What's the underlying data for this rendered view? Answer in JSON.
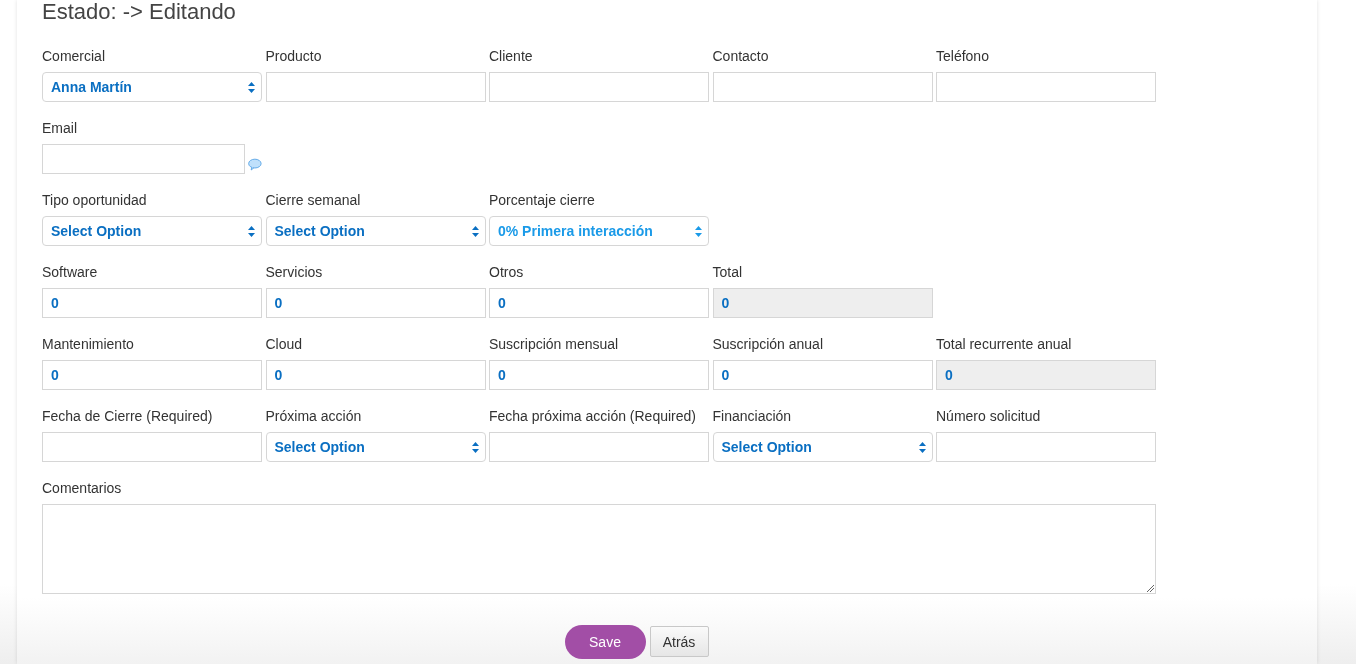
{
  "title": "Estado: -> Editando",
  "rows": [
    {
      "fields": [
        {
          "label": "Comercial",
          "kind": "select",
          "value": "Anna Martín"
        },
        {
          "label": "Producto",
          "kind": "text"
        },
        {
          "label": "Cliente",
          "kind": "text"
        },
        {
          "label": "Contacto",
          "kind": "text"
        },
        {
          "label": "Teléfono",
          "kind": "text"
        }
      ]
    },
    {
      "fields": [
        {
          "label": "Email",
          "kind": "text",
          "comment_icon": true
        }
      ]
    },
    {
      "fields": [
        {
          "label": "Tipo oportunidad",
          "kind": "select",
          "value": "Select Option"
        },
        {
          "label": "Cierre semanal",
          "kind": "select",
          "value": "Select Option"
        },
        {
          "label": "Porcentaje cierre",
          "kind": "select",
          "value": "0% Primera interacción"
        }
      ]
    },
    {
      "fields": [
        {
          "label": "Software",
          "kind": "text",
          "value": "0"
        },
        {
          "label": "Servicios",
          "kind": "text",
          "value": "0"
        },
        {
          "label": "Otros",
          "kind": "text",
          "value": "0"
        },
        {
          "label": "Total",
          "kind": "readonly",
          "value": "0"
        }
      ]
    },
    {
      "fields": [
        {
          "label": "Mantenimiento",
          "kind": "text",
          "value": "0"
        },
        {
          "label": "Cloud",
          "kind": "text",
          "value": "0"
        },
        {
          "label": "Suscripción mensual",
          "kind": "text",
          "value": "0"
        },
        {
          "label": "Suscripción anual",
          "kind": "text",
          "value": "0"
        },
        {
          "label": "Total recurrente anual",
          "kind": "readonly",
          "value": "0"
        }
      ]
    },
    {
      "fields": [
        {
          "label": "Fecha de Cierre (Required)",
          "kind": "text"
        },
        {
          "label": "Próxima acción",
          "kind": "select",
          "value": "Select Option"
        },
        {
          "label": "Fecha próxima acción (Required)",
          "kind": "text"
        },
        {
          "label": "Financiación",
          "kind": "select",
          "value": "Select Option"
        },
        {
          "label": "Número solicitud",
          "kind": "text"
        }
      ]
    }
  ],
  "comments": {
    "label": "Comentarios"
  },
  "buttons": [
    {
      "label": "Save",
      "kind": "primary"
    },
    {
      "label": "Atrás",
      "kind": "secondary"
    }
  ]
}
